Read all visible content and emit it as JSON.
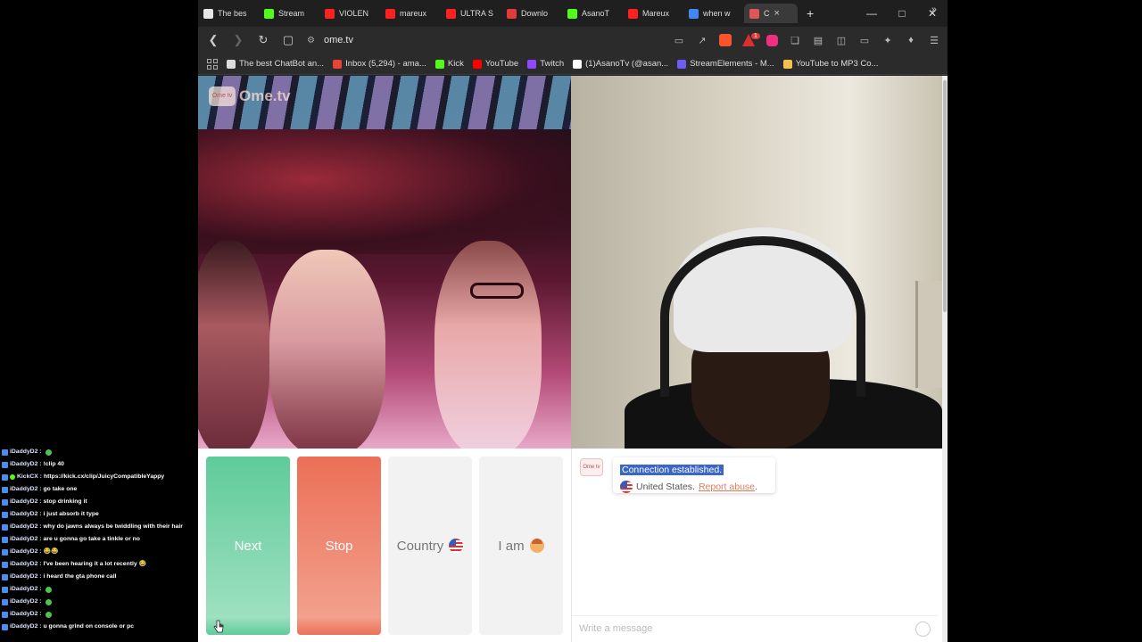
{
  "tabs": [
    {
      "label": "The bes",
      "fav": "#e6e6e6"
    },
    {
      "label": "Stream",
      "fav": "#53fc18"
    },
    {
      "label": "VIOLEN",
      "fav": "#ff2020"
    },
    {
      "label": "mareux",
      "fav": "#ff2020"
    },
    {
      "label": "ULTRA S",
      "fav": "#ff2020"
    },
    {
      "label": "Downlo",
      "fav": "#e33b3b"
    },
    {
      "label": "AsanoT",
      "fav": "#53fc18"
    },
    {
      "label": "Mareux",
      "fav": "#ff2020"
    },
    {
      "label": "when w",
      "fav": "#4285f4"
    },
    {
      "label": "C",
      "fav": "#e05555"
    }
  ],
  "address": {
    "url": "ome.tv"
  },
  "bookmarks": [
    {
      "label": "The best ChatBot an...",
      "fav": "#dddddd"
    },
    {
      "label": "Inbox (5,294) - ama...",
      "fav": "#ea4335"
    },
    {
      "label": "Kick",
      "fav": "#53fc18"
    },
    {
      "label": "YouTube",
      "fav": "#ff0000"
    },
    {
      "label": "Twitch",
      "fav": "#9146ff"
    },
    {
      "label": "(1)AsanoTv (@asan...",
      "fav": "#ffffff"
    },
    {
      "label": "StreamElements - M...",
      "fav": "#6f5cf5"
    },
    {
      "label": "YouTube to MP3 Co...",
      "fav": "#f2c14e"
    }
  ],
  "site": {
    "logo_icon": "Ome tv",
    "logo_text": "Ome.tv"
  },
  "controls": {
    "next": "Next",
    "stop": "Stop",
    "country": "Country",
    "iam": "I am"
  },
  "chat": {
    "avatar_text": "Ome tv",
    "connection": "Connection established.",
    "location": "United States.",
    "report": "Report abuse",
    "report_suffix": ".",
    "placeholder": "Write a message"
  },
  "stream_chat": [
    {
      "user": "iDaddyD2 :",
      "msg": "",
      "emote": true
    },
    {
      "user": "iDaddyD2 :",
      "msg": "!clip 40",
      "emote": false
    },
    {
      "user": "KickCX :",
      "msg": "https://kick.cx/clip/JuicyCompatibleYappy",
      "emote": false,
      "kick": true
    },
    {
      "user": "iDaddyD2 :",
      "msg": "go take one",
      "emote": false
    },
    {
      "user": "iDaddyD2 :",
      "msg": "stop drinking it",
      "emote": false
    },
    {
      "user": "iDaddyD2 :",
      "msg": "i just absorb it type",
      "emote": false
    },
    {
      "user": "iDaddyD2 :",
      "msg": "why do jawns always be twiddling with their hair",
      "emote": false
    },
    {
      "user": "iDaddyD2 :",
      "msg": "are u gonna go take a tinkle or no",
      "emote": false
    },
    {
      "user": "iDaddyD2 :",
      "msg": "😂😂",
      "emote": false
    },
    {
      "user": "iDaddyD2 :",
      "msg": "I've been hearing it a lot recently 😂",
      "emote": false
    },
    {
      "user": "iDaddyD2 :",
      "msg": "i heard the gta phone call",
      "emote": false
    },
    {
      "user": "iDaddyD2 :",
      "msg": "",
      "emote": true
    },
    {
      "user": "iDaddyD2 :",
      "msg": "",
      "emote": true
    },
    {
      "user": "iDaddyD2 :",
      "msg": "",
      "emote": true
    },
    {
      "user": "iDaddyD2 :",
      "msg": "u gonna grind on console or pc",
      "emote": false
    }
  ]
}
